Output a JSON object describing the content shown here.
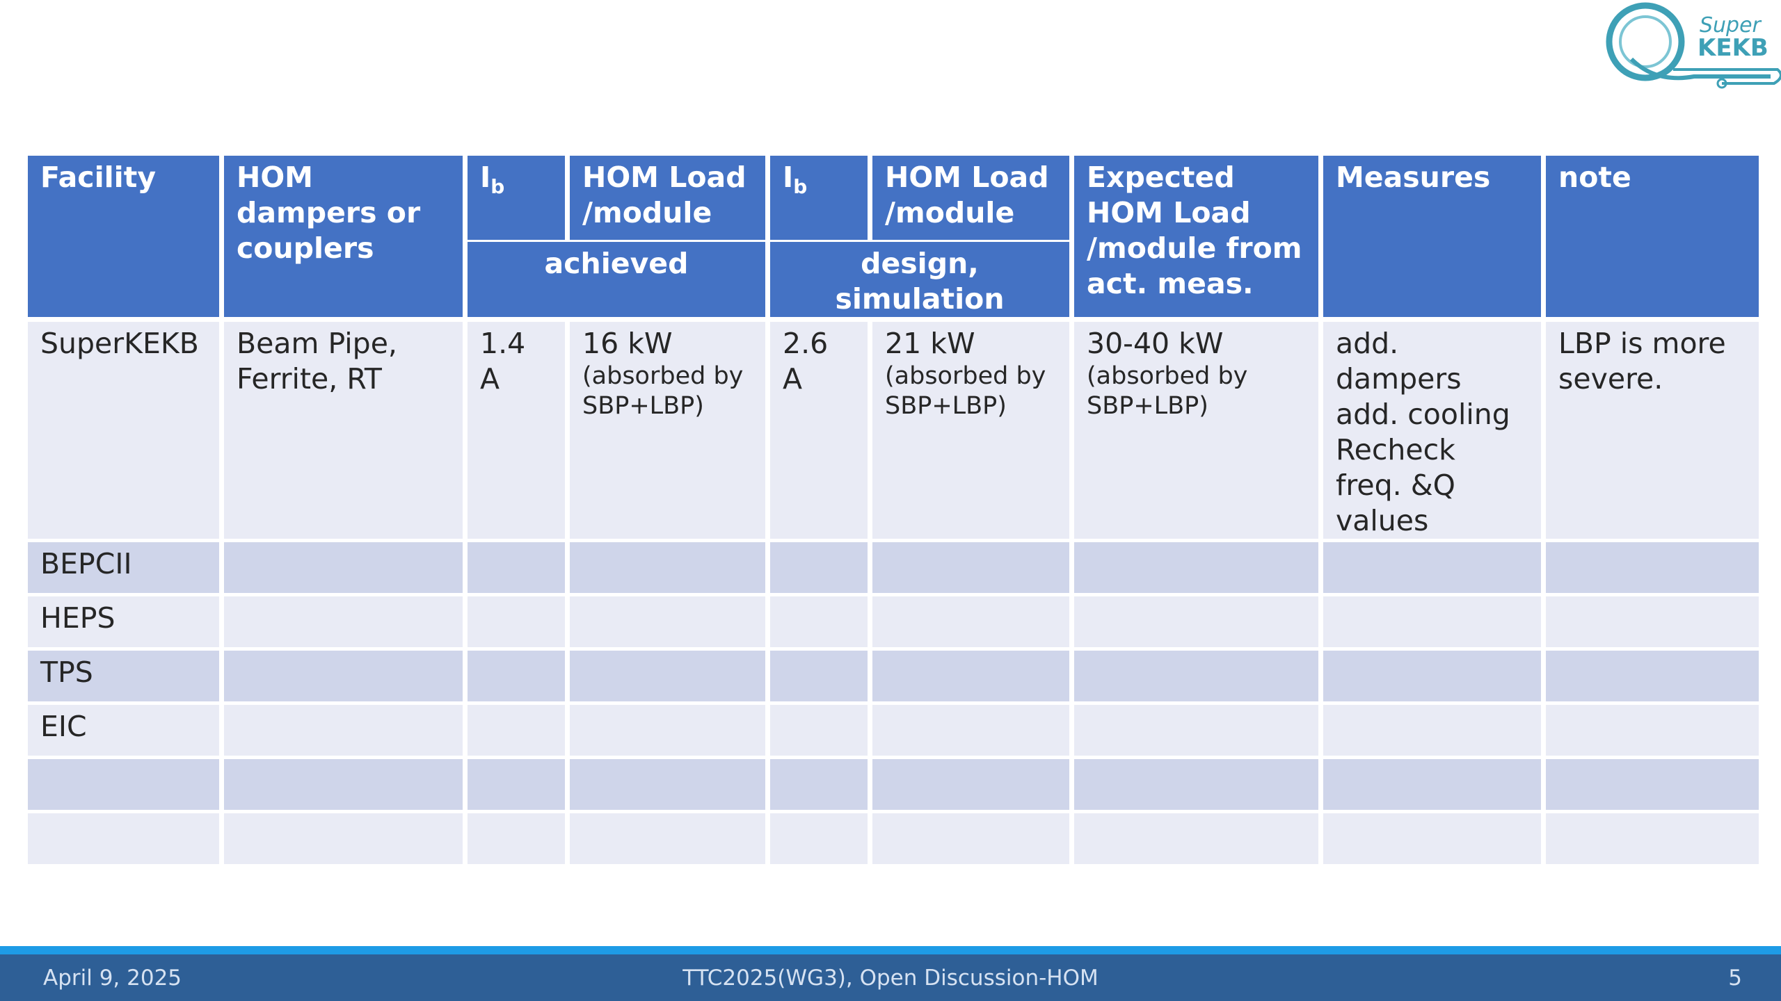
{
  "logo": {
    "text_line1": "Super",
    "text_line2": "KEKB",
    "icon": "superkekb-logo"
  },
  "table": {
    "headers": {
      "facility": "Facility",
      "hom_dampers": "HOM dampers or couplers",
      "ib_achieved_main": "I",
      "ib_achieved_sub": "b",
      "hom_load_achieved": "HOM Load /module",
      "achieved": "achieved",
      "ib_design_main": "I",
      "ib_design_sub": "b",
      "hom_load_design": "HOM Load /module",
      "design_simulation": "design, simulation",
      "expected": "Expected HOM Load /module from act. meas.",
      "measures": "Measures",
      "note": "note"
    },
    "rows": [
      {
        "facility": "SuperKEKB",
        "dampers": "Beam Pipe, Ferrite, RT",
        "ib_achieved": "1.4 A",
        "load_achieved": "16 kW",
        "load_achieved_note": "(absorbed by SBP+LBP)",
        "ib_design": "2.6 A",
        "load_design": "21 kW",
        "load_design_note": "(absorbed by SBP+LBP)",
        "expected": "30-40 kW",
        "expected_note": "(absorbed by SBP+LBP)",
        "measures": "add. dampers add. cooling Recheck freq. &Q values",
        "note": "LBP is more severe."
      },
      {
        "facility": "BEPCII"
      },
      {
        "facility": "HEPS"
      },
      {
        "facility": "TPS"
      },
      {
        "facility": "EIC"
      },
      {
        "facility": ""
      },
      {
        "facility": ""
      }
    ]
  },
  "footer": {
    "date": "April 9, 2025",
    "title": "TTC2025(WG3), Open Discussion-HOM",
    "page": "5"
  },
  "colors": {
    "header_bg": "#4472c4",
    "row_light": "#e9ebf5",
    "row_dark": "#cfd5ea",
    "footer_bg": "#2e5f96",
    "footer_stripe": "#1e9be6",
    "logo": "#3ea0b6"
  }
}
